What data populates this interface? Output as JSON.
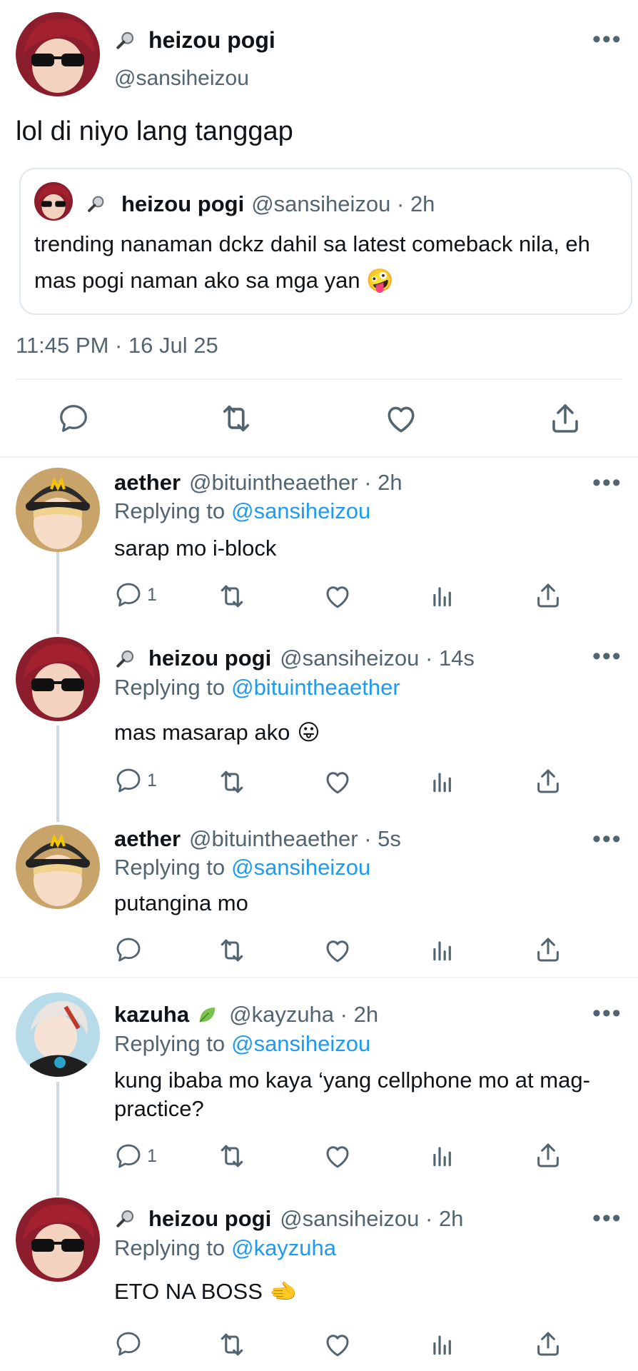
{
  "main_tweet": {
    "name": "heizou pogi",
    "handle": "@sansiheizou",
    "text": "lol di niyo lang tanggap",
    "quote": {
      "name": "heizou pogi",
      "handle_time": "@sansiheizou · 2h",
      "text": "trending nanaman dckz dahil sa latest comeback nila, eh mas pogi naman ako sa mga yan",
      "emoji": "🤪"
    },
    "timestamp": "11:45 PM · 16 Jul 25"
  },
  "replies": [
    {
      "name": "aether",
      "meta": "@bituintheaether · 2h",
      "replying_label": "Replying to",
      "replying_to": "@sansiheizou",
      "text": "sarap mo i-block",
      "emoji": "",
      "reply_count": "1"
    },
    {
      "name": "heizou pogi",
      "meta": "@sansiheizou · 14s",
      "replying_label": "Replying to",
      "replying_to": "@bituintheaether",
      "text": "mas masarap ako",
      "emoji": "😛",
      "reply_count": "1"
    },
    {
      "name": "aether",
      "meta": "@bituintheaether · 5s",
      "replying_label": "Replying to",
      "replying_to": "@sansiheizou",
      "text": "putangina mo",
      "emoji": "",
      "reply_count": ""
    },
    {
      "name": "kazuha",
      "meta": "@kayzuha · 2h",
      "replying_label": "Replying to",
      "replying_to": "@sansiheizou",
      "text": "kung ibaba mo kaya ‘yang cellphone mo at mag-practice?",
      "emoji": "",
      "reply_count": "1"
    },
    {
      "name": "heizou pogi",
      "meta": "@sansiheizou · 2h",
      "replying_label": "Replying to",
      "replying_to": "@kayzuha",
      "text": "ETO NA BOSS",
      "emoji": "🫲",
      "reply_count": ""
    }
  ],
  "more_glyph": "•••",
  "colors": {
    "accent": "#1d9bf0",
    "gray": "#536471",
    "border": "#cfd9de"
  }
}
